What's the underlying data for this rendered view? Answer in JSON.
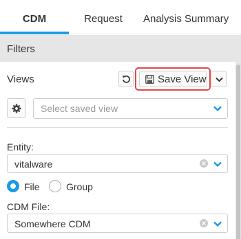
{
  "tabs": [
    {
      "label": "CDM",
      "active": true
    },
    {
      "label": "Request",
      "active": false
    },
    {
      "label": "Analysis Summary",
      "active": false
    }
  ],
  "filters": {
    "title": "Filters"
  },
  "views": {
    "label": "Views",
    "save_label": "Save View",
    "reset_icon": "undo-icon",
    "save_icon": "floppy-disk-icon",
    "more_icon": "chevron-down-icon",
    "settings_icon": "gear-icon",
    "saved_view_placeholder": "Select saved view"
  },
  "entity": {
    "label": "Entity:",
    "value": "vitalware"
  },
  "source_type": {
    "options": [
      {
        "label": "File",
        "selected": true
      },
      {
        "label": "Group",
        "selected": false
      }
    ]
  },
  "cdm_file": {
    "label": "CDM File:",
    "value": "Somewhere CDM"
  },
  "colors": {
    "accent": "#1a9be6",
    "highlight": "#e0484a",
    "filters_bar": "#e6e6e6"
  }
}
